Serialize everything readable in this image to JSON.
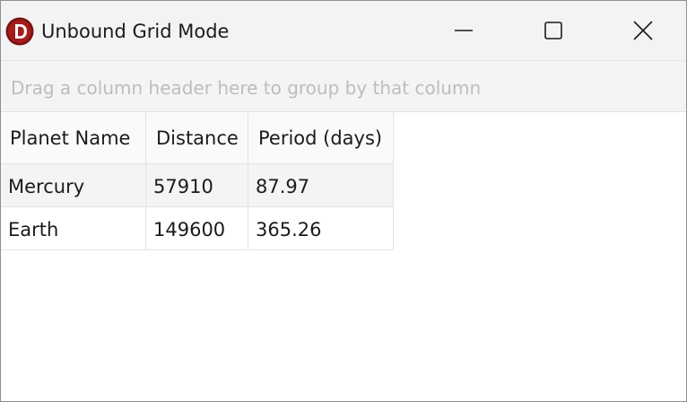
{
  "window": {
    "title": "Unbound Grid Mode",
    "icons": {
      "app": "app-logo-icon",
      "minimize": "minimize-icon",
      "maximize": "maximize-icon",
      "close": "close-icon"
    },
    "colors": {
      "logo_red": "#8b1a1a",
      "titlebar_bg": "#f3f3f3"
    }
  },
  "group_panel": {
    "hint": "Drag a column header here to group by that column"
  },
  "grid": {
    "columns": [
      "Planet Name",
      "Distance",
      "Period (days)"
    ],
    "rows": [
      [
        "Mercury",
        "57910",
        "87.97"
      ],
      [
        "Earth",
        "149600",
        "365.26"
      ]
    ]
  }
}
